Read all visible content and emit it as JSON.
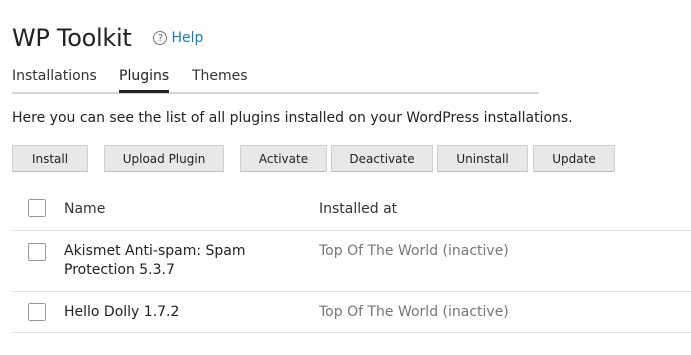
{
  "header": {
    "title": "WP Toolkit",
    "help_label": "Help",
    "help_icon": "?"
  },
  "tabs": [
    {
      "label": "Installations",
      "active": false
    },
    {
      "label": "Plugins",
      "active": true
    },
    {
      "label": "Themes",
      "active": false
    }
  ],
  "description": "Here you can see the list of all plugins installed on your WordPress installations.",
  "toolbar": {
    "install": "Install",
    "upload_plugin": "Upload Plugin",
    "activate": "Activate",
    "deactivate": "Deactivate",
    "uninstall": "Uninstall",
    "update": "Update"
  },
  "table": {
    "columns": {
      "name": "Name",
      "installed_at": "Installed at"
    },
    "rows": [
      {
        "name": "Akismet Anti-spam: Spam Protection 5.3.7",
        "installed_at": "Top Of The World (inactive)"
      },
      {
        "name": "Hello Dolly 1.7.2",
        "installed_at": "Top Of The World (inactive)"
      }
    ]
  }
}
